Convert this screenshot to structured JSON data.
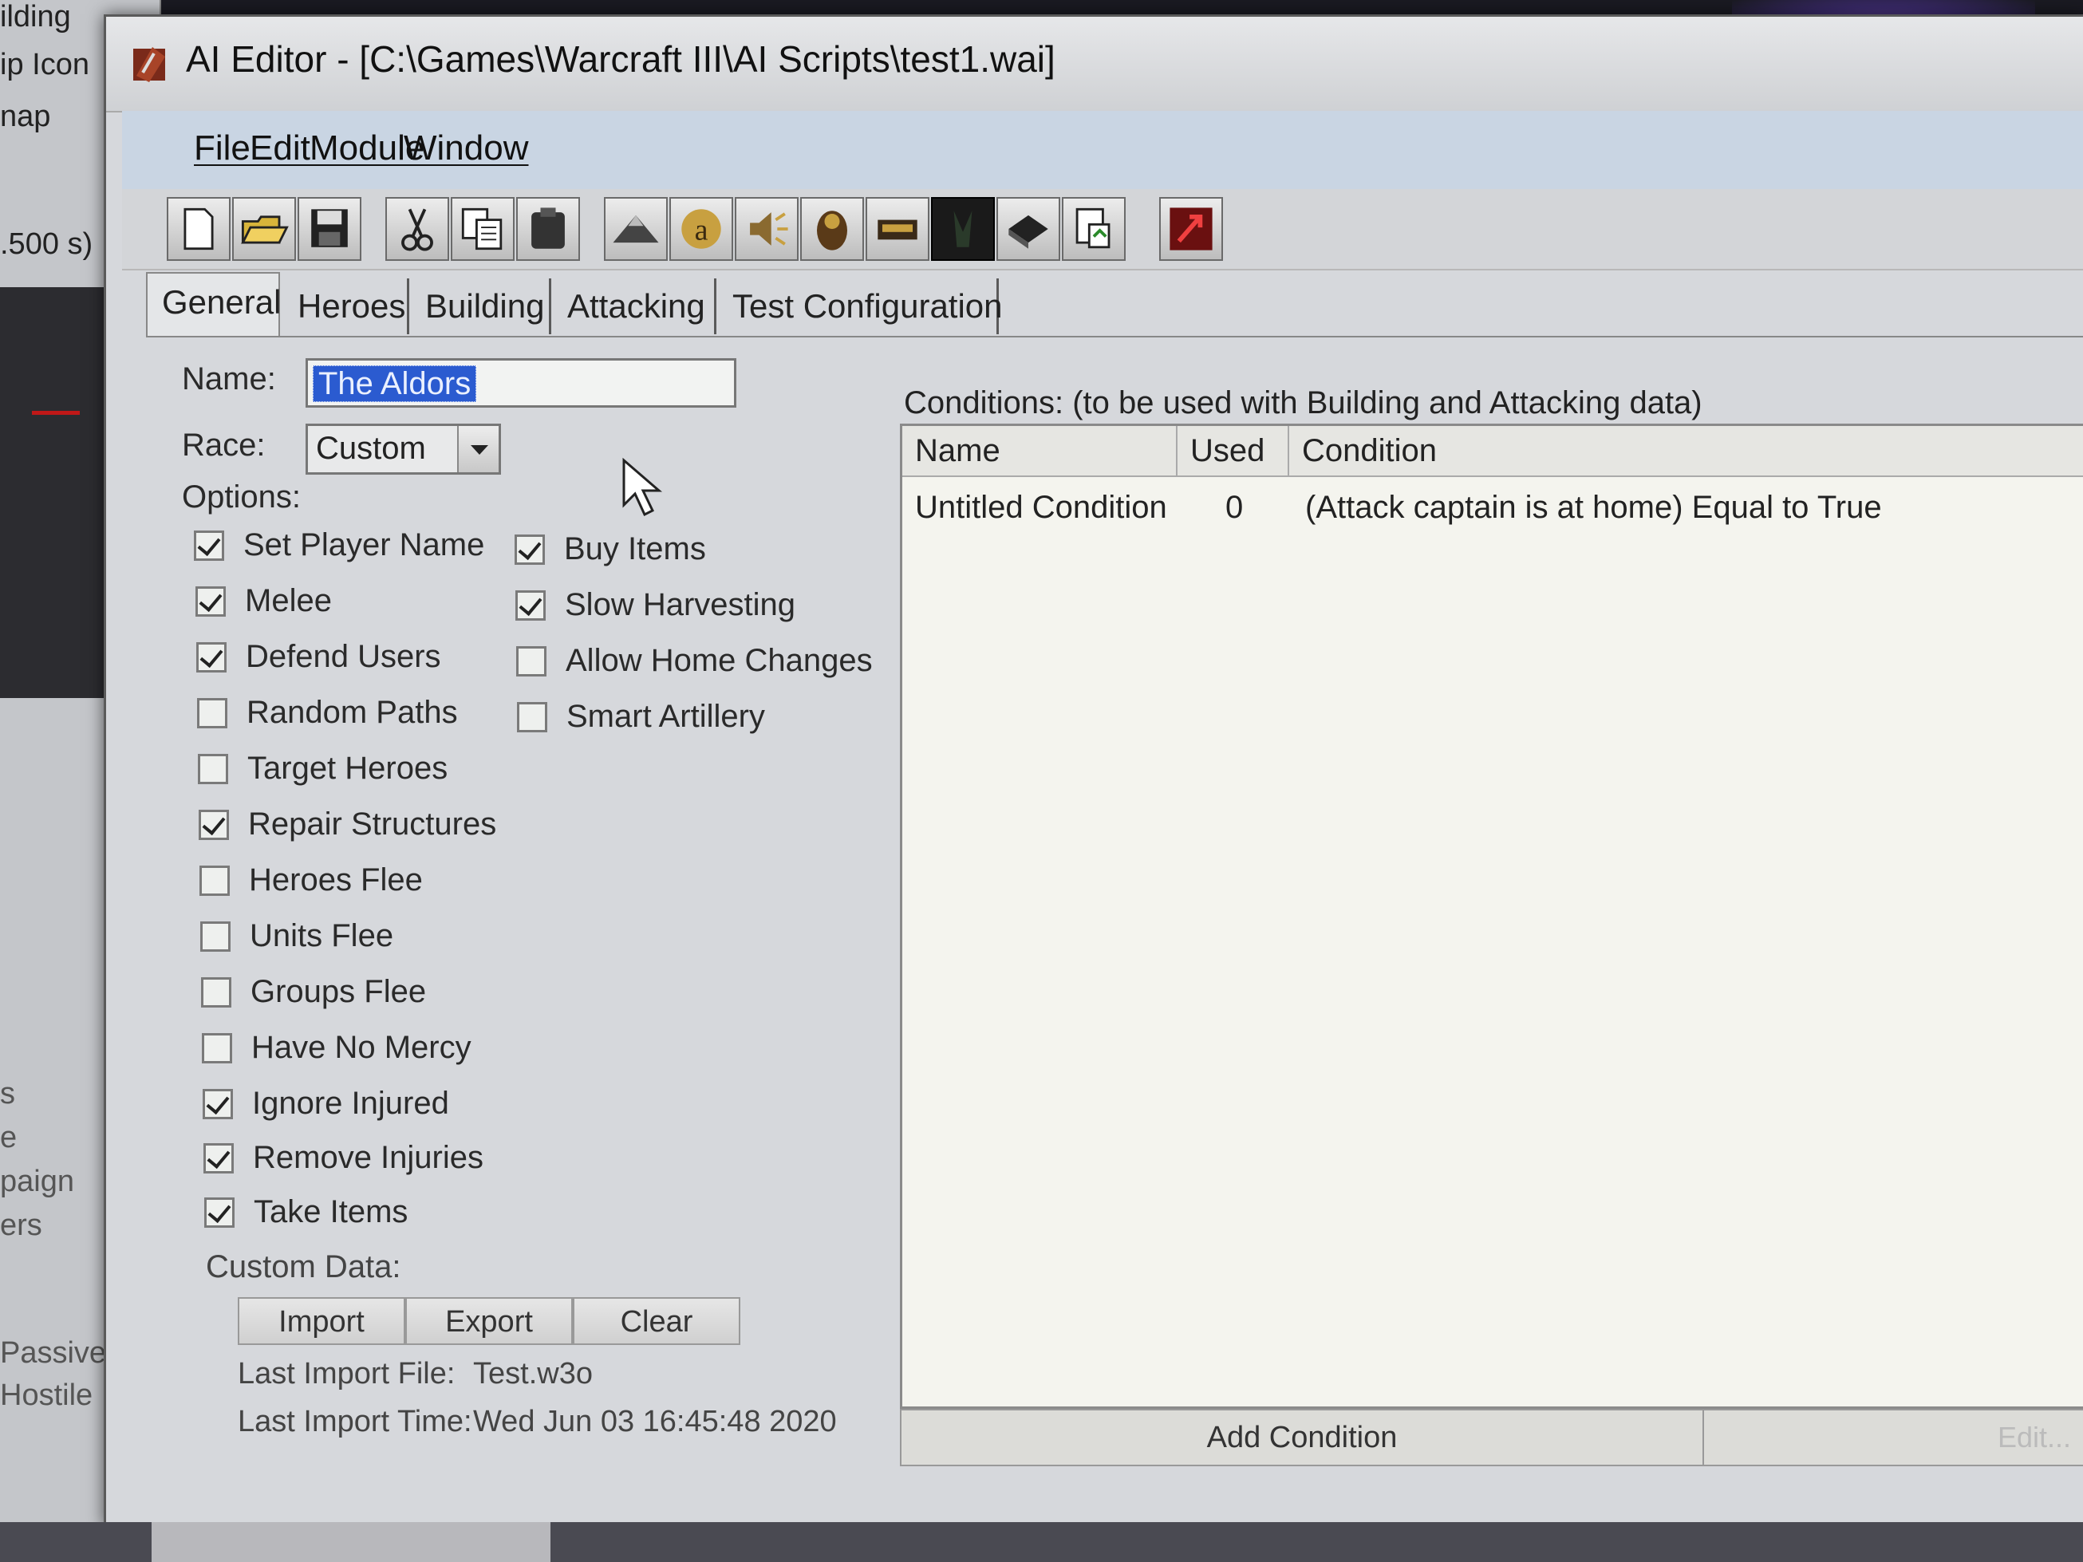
{
  "background": {
    "fragments": [
      "ilding",
      "ip Icon",
      "nap",
      ".500 s)",
      "s",
      "e",
      "paign",
      "ers",
      "Passive",
      "Hostile"
    ]
  },
  "window": {
    "title": "AI Editor - [C:\\Games\\Warcraft III\\AI Scripts\\test1.wai]"
  },
  "menu": {
    "items": [
      "File",
      "Edit",
      "Module",
      "Window"
    ]
  },
  "toolbar": {
    "buttons": [
      "new-icon",
      "open-icon",
      "save-icon",
      "cut-icon",
      "copy-icon",
      "paste-icon",
      "terrain-icon",
      "text-icon",
      "sound-icon",
      "object-icon",
      "unit-icon",
      "ai-editor-icon",
      "script-icon",
      "import-icon",
      "test-map-icon"
    ]
  },
  "tabs": [
    "General",
    "Heroes",
    "Building",
    "Attacking",
    "Test Configuration"
  ],
  "general": {
    "name_label": "Name:",
    "name_value": "The Aldors",
    "race_label": "Race:",
    "race_value": "Custom",
    "options_label": "Options:",
    "options_left": [
      {
        "label": "Set Player Name",
        "checked": true
      },
      {
        "label": "Melee",
        "checked": true
      },
      {
        "label": "Defend Users",
        "checked": true
      },
      {
        "label": "Random Paths",
        "checked": false
      },
      {
        "label": "Target Heroes",
        "checked": false
      },
      {
        "label": "Repair Structures",
        "checked": true
      },
      {
        "label": "Heroes Flee",
        "checked": false
      },
      {
        "label": "Units Flee",
        "checked": false
      },
      {
        "label": "Groups Flee",
        "checked": false
      },
      {
        "label": "Have No Mercy",
        "checked": false
      },
      {
        "label": "Ignore Injured",
        "checked": true
      },
      {
        "label": "Remove Injuries",
        "checked": true
      },
      {
        "label": "Take Items",
        "checked": true
      }
    ],
    "options_right": [
      {
        "label": "Buy Items",
        "checked": true
      },
      {
        "label": "Slow Harvesting",
        "checked": true
      },
      {
        "label": "Allow Home Changes",
        "checked": false
      },
      {
        "label": "Smart Artillery",
        "checked": false
      }
    ],
    "custom_data_label": "Custom Data:",
    "import_label": "Import",
    "export_label": "Export",
    "clear_label": "Clear",
    "last_import_file_label": "Last Import File:",
    "last_import_file": "Test.w3o",
    "last_import_time_label": "Last Import Time:",
    "last_import_time": "Wed Jun 03 16:45:48 2020"
  },
  "conditions": {
    "title": "Conditions: (to be used with Building and Attacking data)",
    "columns": [
      "Name",
      "Used",
      "Condition"
    ],
    "rows": [
      {
        "name": "Untitled Condition",
        "used": "0",
        "condition": "(Attack captain is at home) Equal to True"
      }
    ],
    "add_label": "Add Condition",
    "edit_label": "Edit..."
  }
}
